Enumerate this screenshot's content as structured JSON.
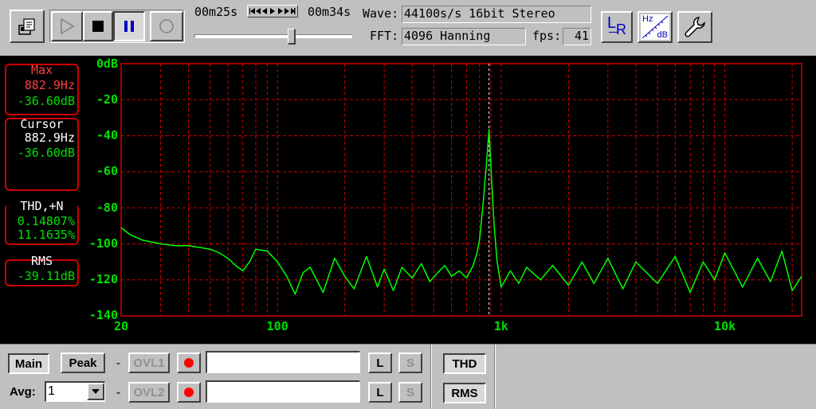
{
  "toolbar": {
    "elapsed_time": "00m25s",
    "total_time": "00m34s",
    "seek_position": 0.62,
    "wave_label": "Wave:",
    "wave_value": "44100s/s 16bit Stereo",
    "fft_label": "FFT:",
    "fft_value": "4096 Hanning",
    "fps_label": "fps:",
    "fps_value": "41",
    "lr_label": "LR",
    "hz_label": "Hz",
    "db_label": "dB",
    "icons": [
      "open-file-icon",
      "play-icon",
      "stop-icon",
      "pause-icon",
      "record-icon",
      "channel-lr-icon",
      "hz-db-scale-icon",
      "settings-wrench-icon"
    ]
  },
  "readouts": {
    "max": {
      "title": "Max",
      "freq": "882.9Hz",
      "level": "-36.60dB"
    },
    "cursor": {
      "title": "Cursor",
      "freq": "882.9Hz",
      "level": "-36.60dB"
    },
    "thd": {
      "title": "THD,+N",
      "line1": "0.14807%",
      "line2": "11.1635%"
    },
    "rms": {
      "title": "RMS",
      "value": "-39.11dB"
    }
  },
  "chart_data": {
    "type": "line",
    "x_scale": "log",
    "xlim": [
      20,
      22050
    ],
    "ylim": [
      -140,
      0
    ],
    "grid": true,
    "y_ticks": [
      "0dB",
      "-20",
      "-40",
      "-60",
      "-80",
      "-100",
      "-120",
      "-140"
    ],
    "x_ticks": [
      {
        "label": "20",
        "value": 20
      },
      {
        "label": "100",
        "value": 100
      },
      {
        "label": "1k",
        "value": 1000
      },
      {
        "label": "10k",
        "value": 10000
      }
    ],
    "cursor_x": 882.9,
    "colors": {
      "grid": "#d00000",
      "trace": "#00ff00",
      "cursor": "#ffffff",
      "background": "#000000"
    },
    "series": [
      {
        "x": [
          20,
          22,
          25,
          30,
          35,
          40,
          45,
          50,
          55,
          60,
          65,
          70,
          75,
          80,
          90,
          100,
          110,
          120,
          130,
          140,
          160,
          180,
          200,
          220,
          250,
          280,
          300,
          330,
          360,
          400,
          440,
          480,
          520,
          560,
          600,
          650,
          700,
          750,
          780,
          800,
          830,
          860,
          882.9,
          900,
          930,
          960,
          1000,
          1100,
          1200,
          1300,
          1500,
          1700,
          2000,
          2300,
          2600,
          3000,
          3500,
          4000,
          5000,
          6000,
          7000,
          8000,
          9000,
          10000,
          12000,
          14000,
          16000,
          18000,
          20000,
          22050
        ],
        "y": [
          -91,
          -95,
          -98,
          -100,
          -101,
          -101,
          -102,
          -103,
          -105,
          -108,
          -112,
          -115,
          -110,
          -103,
          -104,
          -110,
          -118,
          -128,
          -116,
          -113,
          -127,
          -108,
          -118,
          -125,
          -107,
          -124,
          -114,
          -126,
          -113,
          -119,
          -111,
          -121,
          -116,
          -112,
          -118,
          -115,
          -119,
          -112,
          -105,
          -98,
          -78,
          -55,
          -36.6,
          -58,
          -90,
          -110,
          -124,
          -115,
          -122,
          -113,
          -120,
          -112,
          -123,
          -110,
          -122,
          -108,
          -125,
          -110,
          -122,
          -107,
          -127,
          -110,
          -120,
          -105,
          -124,
          -108,
          -121,
          -104,
          -126,
          -118
        ]
      }
    ]
  },
  "bottom": {
    "main_label": "Main",
    "peak_label": "Peak",
    "ovl1_label": "OVL1",
    "ovl2_label": "OVL2",
    "avg_label": "Avg:",
    "avg_value": "1",
    "dash": "-",
    "l_label": "L",
    "s_label": "S",
    "thd_label": "THD",
    "rms_label": "RMS",
    "overlay1_text": "",
    "overlay2_text": ""
  }
}
